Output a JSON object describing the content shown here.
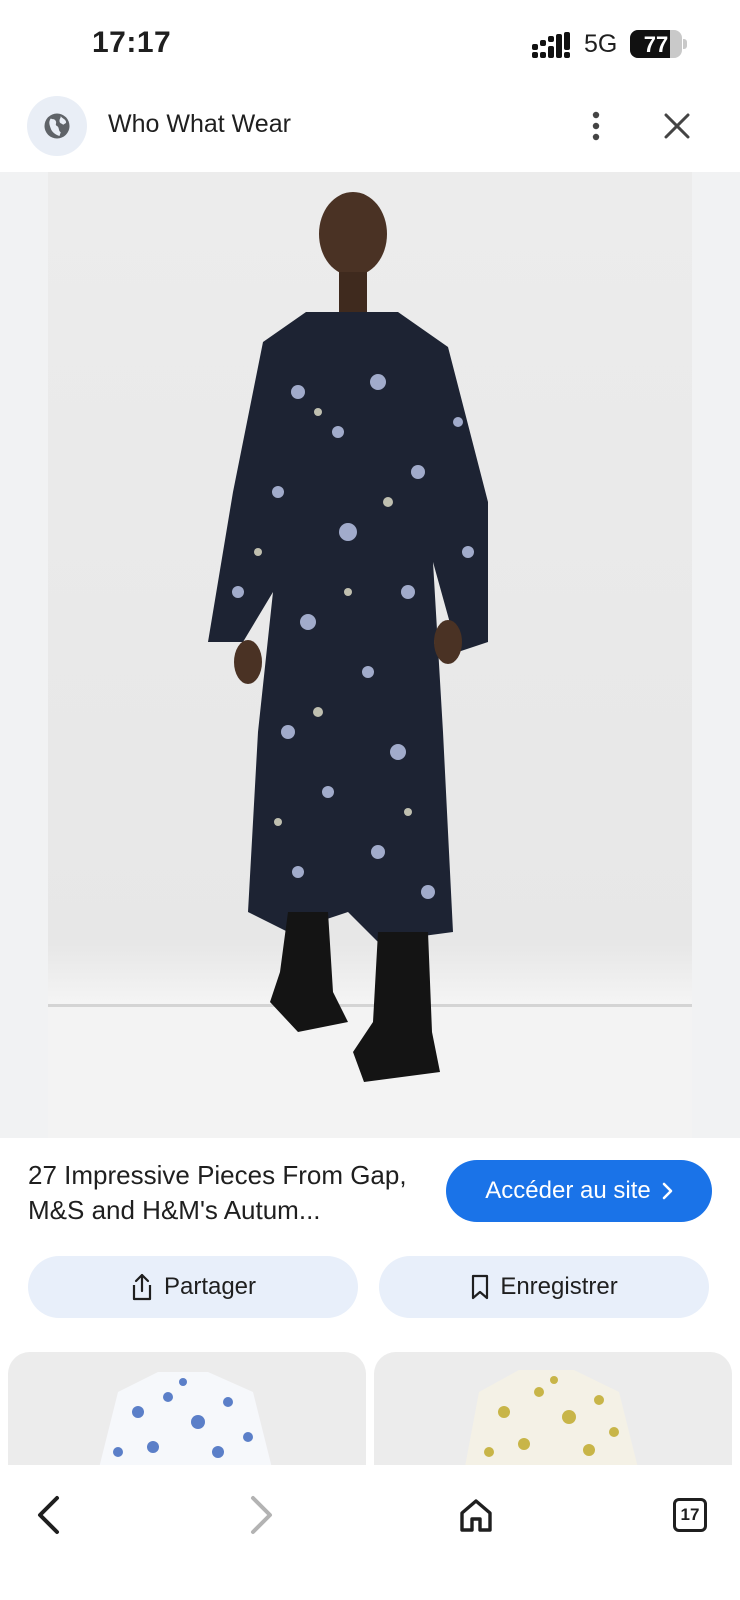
{
  "status_bar": {
    "time": "17:17",
    "network": "5G",
    "battery_level": "77",
    "battery_fraction": 0.77
  },
  "header": {
    "site_name": "Who What Wear",
    "icons": [
      "globe-icon",
      "more-vert-icon",
      "close-icon"
    ]
  },
  "result": {
    "title": "27 Impressive Pieces From Gap, M&S and H&M's Autum...",
    "visit_label": "Accéder au site",
    "share_label": "Partager",
    "save_label": "Enregistrer"
  },
  "bottom_nav": {
    "tabs_count": "17",
    "icons": [
      "back-icon",
      "forward-icon",
      "home-icon",
      "tabs-icon"
    ]
  },
  "colors": {
    "accent": "#1a73e8",
    "chip_background": "#e8effa",
    "text": "#1f1f1f"
  }
}
